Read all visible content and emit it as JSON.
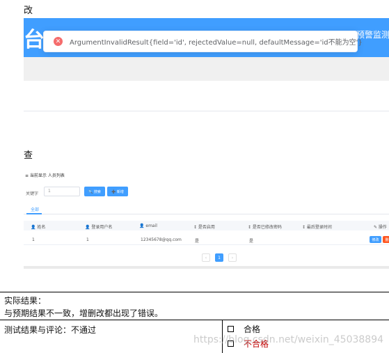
{
  "headings": {
    "modify": "改",
    "query": "查"
  },
  "screenshot_modify": {
    "logo_char": "台",
    "header_right_text": "预警监测",
    "error_message": "ArgumentInvalidResult{field='id', rejectedValue=null, defaultMessage='id不能为空'}"
  },
  "screenshot_query": {
    "breadcrumb": "≡ 当前显示  人员列表",
    "search": {
      "label": "关键字",
      "value": "1",
      "search_button": "🔍 搜索",
      "add_button": "➕ 新增"
    },
    "tabs": [
      "全部"
    ],
    "columns": [
      "👤 姓名",
      "👤 登录用户名",
      "👤 email",
      "↕ 是否启用",
      "↕ 是否已修改密码",
      "↕ 最后登录时间",
      "✎ 操作"
    ],
    "rows": [
      {
        "name": "1",
        "username": "1",
        "email": "12345678@qq.com",
        "enabled": "是",
        "pwd_changed": "是",
        "last_login": ""
      }
    ],
    "row_actions": {
      "edit": "修改",
      "delete": "删"
    },
    "pagination": {
      "prev": "‹",
      "current": "1",
      "next": "›"
    },
    "colors": {
      "primary": "#409eff",
      "danger": "#ff5722"
    }
  },
  "result": {
    "title": "实际结果：",
    "text": "与预期结果不一致，增删改都出现了错误。",
    "verdict": "测试结果与评论：不通过",
    "options": {
      "pass": "合格",
      "fail": "不合格"
    }
  },
  "watermark": "https://blog.csdn.net/weixin_45038894"
}
